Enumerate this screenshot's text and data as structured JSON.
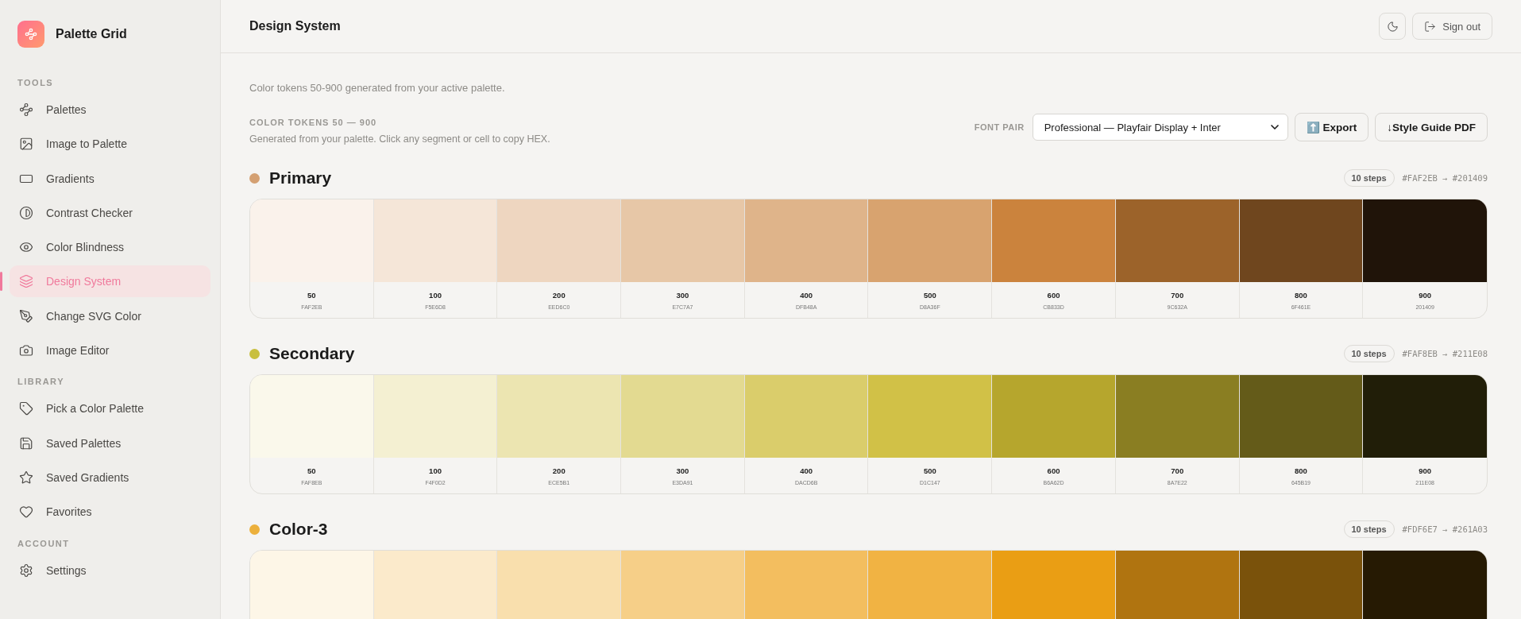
{
  "brand": {
    "name": "Palette Grid"
  },
  "sidebar": {
    "sections": [
      {
        "heading": "TOOLS",
        "items": [
          {
            "label": "Palettes",
            "selected": false
          },
          {
            "label": "Image to Palette",
            "selected": false
          },
          {
            "label": "Gradients",
            "selected": false
          },
          {
            "label": "Contrast Checker",
            "selected": false
          },
          {
            "label": "Color Blindness",
            "selected": false
          },
          {
            "label": "Design System",
            "selected": true
          },
          {
            "label": "Change SVG Color",
            "selected": false
          },
          {
            "label": "Image Editor",
            "selected": false
          }
        ]
      },
      {
        "heading": "LIBRARY",
        "items": [
          {
            "label": "Pick a Color Palette",
            "selected": false
          },
          {
            "label": "Saved Palettes",
            "selected": false
          },
          {
            "label": "Saved Gradients",
            "selected": false
          },
          {
            "label": "Favorites",
            "selected": false
          }
        ]
      },
      {
        "heading": "ACCOUNT",
        "items": [
          {
            "label": "Settings",
            "selected": false
          }
        ]
      }
    ]
  },
  "header": {
    "title": "Design System",
    "sign_out": "Sign out"
  },
  "intro": "Color tokens 50-900 generated from your active palette.",
  "tokens": {
    "heading": "COLOR TOKENS 50 — 900",
    "subtitle": "Generated from your palette. Click any segment or cell to copy HEX.",
    "font_pair_label": "FONT PAIR",
    "font_pair_value": "Professional — Playfair Display + Inter",
    "export": "Export",
    "export_emoji": "⬆️",
    "style_guide": "↓Style Guide PDF"
  },
  "palettes": [
    {
      "name": "Primary",
      "color": "#d4a072",
      "steps": "10 steps",
      "range": "#FAF2EB → #201409",
      "swatches": [
        {
          "step": "50",
          "hex": "FAF2EB",
          "color": "#faf2eb"
        },
        {
          "step": "100",
          "hex": "F5E6D8",
          "color": "#f5e6d8"
        },
        {
          "step": "200",
          "hex": "EED6C0",
          "color": "#eed6c0"
        },
        {
          "step": "300",
          "hex": "E7C7A7",
          "color": "#e7c7a7"
        },
        {
          "step": "400",
          "hex": "DFB48A",
          "color": "#dfb48a"
        },
        {
          "step": "500",
          "hex": "D8A36F",
          "color": "#d8a36f"
        },
        {
          "step": "600",
          "hex": "CB833D",
          "color": "#cb833d"
        },
        {
          "step": "700",
          "hex": "9C632A",
          "color": "#9c632a"
        },
        {
          "step": "800",
          "hex": "6F461E",
          "color": "#6f461e"
        },
        {
          "step": "900",
          "hex": "201409",
          "color": "#201409"
        }
      ]
    },
    {
      "name": "Secondary",
      "color": "#c8bf3e",
      "steps": "10 steps",
      "range": "#FAF8EB → #211E08",
      "swatches": [
        {
          "step": "50",
          "hex": "FAF8EB",
          "color": "#faf8eb"
        },
        {
          "step": "100",
          "hex": "F4F0D2",
          "color": "#f4f0d2"
        },
        {
          "step": "200",
          "hex": "ECE5B1",
          "color": "#ece5b1"
        },
        {
          "step": "300",
          "hex": "E3DA91",
          "color": "#e3da91"
        },
        {
          "step": "400",
          "hex": "DACD6B",
          "color": "#dacd6b"
        },
        {
          "step": "500",
          "hex": "D1C147",
          "color": "#d1c147"
        },
        {
          "step": "600",
          "hex": "B6A62D",
          "color": "#b6a62d"
        },
        {
          "step": "700",
          "hex": "8A7E22",
          "color": "#8a7e22"
        },
        {
          "step": "800",
          "hex": "645B19",
          "color": "#645b19"
        },
        {
          "step": "900",
          "hex": "211E08",
          "color": "#211e08"
        }
      ]
    },
    {
      "name": "Color-3",
      "color": "#ecb03c",
      "steps": "10 steps",
      "range": "#FDF6E7 → #261A03",
      "swatches": [
        {
          "color": "#fdf6e7"
        },
        {
          "color": "#fbeacb"
        },
        {
          "color": "#f9dfad"
        },
        {
          "color": "#f6cf88"
        },
        {
          "color": "#f3be5f"
        },
        {
          "color": "#f1b343"
        },
        {
          "color": "#ea9e14"
        },
        {
          "color": "#b07410"
        },
        {
          "color": "#7a520b"
        },
        {
          "color": "#261a03"
        }
      ]
    }
  ]
}
